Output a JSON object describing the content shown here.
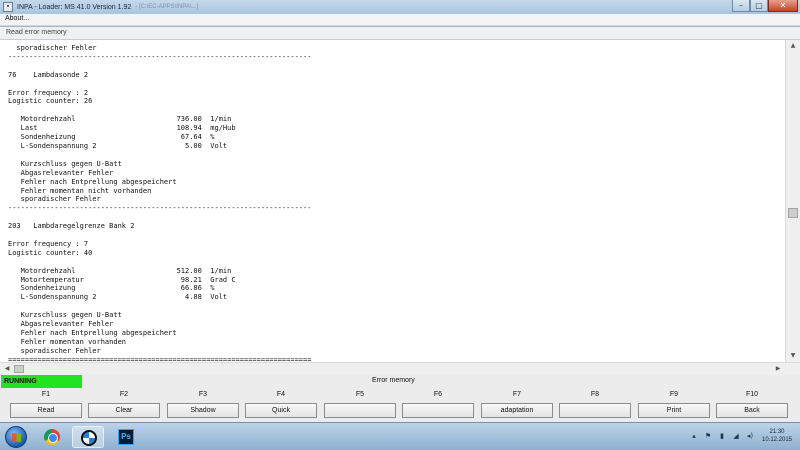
{
  "window": {
    "title": "INPA - Loader:  MS 41.0 Version 1.92",
    "title_extra": "- [C:\\EC-APPS\\INPA\\...]",
    "minimize_icon": "minimize-icon",
    "maximize_icon": "maximize-icon",
    "close_icon": "close-icon"
  },
  "menu": {
    "about": "About..."
  },
  "panel_label": "Read error memory",
  "content": {
    "lines": [
      "  sporadischer Fehler",
      "------------------------------------------------------------------------",
      "",
      "76    Lambdasonde 2",
      "",
      "Error frequency : 2",
      "Logistic counter: 26",
      "",
      "   Motordrehzahl                        736.00  1/min",
      "   Last                                 108.94  mg/Hub",
      "   Sondenheizung                         67.64  %",
      "   L-Sondenspannung 2                     5.00  Volt",
      "",
      "   Kurzschluss gegen U-Batt",
      "   Abgasrelevanter Fehler",
      "   Fehler nach Entprellung abgespeichert",
      "   Fehler momentan nicht vorhanden",
      "   sporadischer Fehler",
      "------------------------------------------------------------------------",
      "",
      "203   Lambdaregelgrenze Bank 2",
      "",
      "Error frequency : 7",
      "Logistic counter: 40",
      "",
      "   Motordrehzahl                        512.00  1/min",
      "   Motortemperatur                       98.21  Grad C",
      "   Sondenheizung                         66.86  %",
      "   L-Sondenspannung 2                     4.88  Volt",
      "",
      "   Kurzschluss gegen U-Batt",
      "   Abgasrelevanter Fehler",
      "   Fehler nach Entprellung abgespeichert",
      "   Fehler momentan vorhanden",
      "   sporadischer Fehler",
      "========================================================================"
    ]
  },
  "status": {
    "state": "RUNNING",
    "state_color": "#21e321",
    "title": "Error memory"
  },
  "fkeys": [
    {
      "key": "F1",
      "label": "Read"
    },
    {
      "key": "F2",
      "label": "Clear"
    },
    {
      "key": "F3",
      "label": "Shadow"
    },
    {
      "key": "F4",
      "label": "Quick"
    },
    {
      "key": "F5",
      "label": ""
    },
    {
      "key": "F6",
      "label": ""
    },
    {
      "key": "F7",
      "label": "adaptation"
    },
    {
      "key": "F8",
      "label": ""
    },
    {
      "key": "F9",
      "label": "Print"
    },
    {
      "key": "F10",
      "label": "Back"
    }
  ],
  "taskbar": {
    "apps": [
      {
        "name": "chrome-icon"
      },
      {
        "name": "bmw-inpa-icon"
      },
      {
        "name": "photoshop-icon",
        "text": "Ps"
      }
    ],
    "tray_icons": [
      "chevron-up-icon",
      "flag-icon",
      "battery-icon",
      "network-icon",
      "volume-icon"
    ],
    "time": "21:30",
    "date": "10.12.2015"
  }
}
